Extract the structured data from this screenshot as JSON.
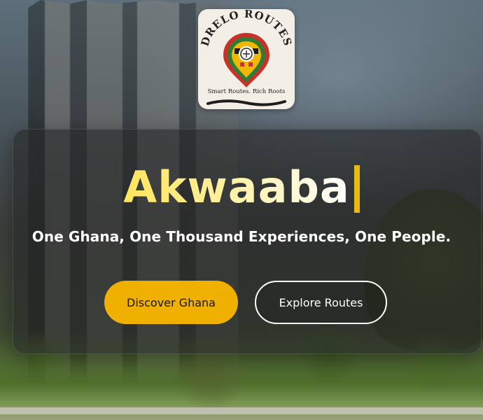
{
  "logo": {
    "name": "DRELO ROUTES",
    "tagline": "Smart Routes. Rich Roots",
    "icon": "map-pin-icon"
  },
  "hero": {
    "title": "Akwaaba",
    "subtitle": "One Ghana, One Thousand Experiences, One People.",
    "caret_color": "#e9b91a"
  },
  "buttons": {
    "primary_label": "Discover Ghana",
    "secondary_label": "Explore Routes"
  },
  "colors": {
    "accent": "#f0b000",
    "title_gradient_start": "#ffe55c",
    "title_gradient_end": "#ffffff"
  }
}
